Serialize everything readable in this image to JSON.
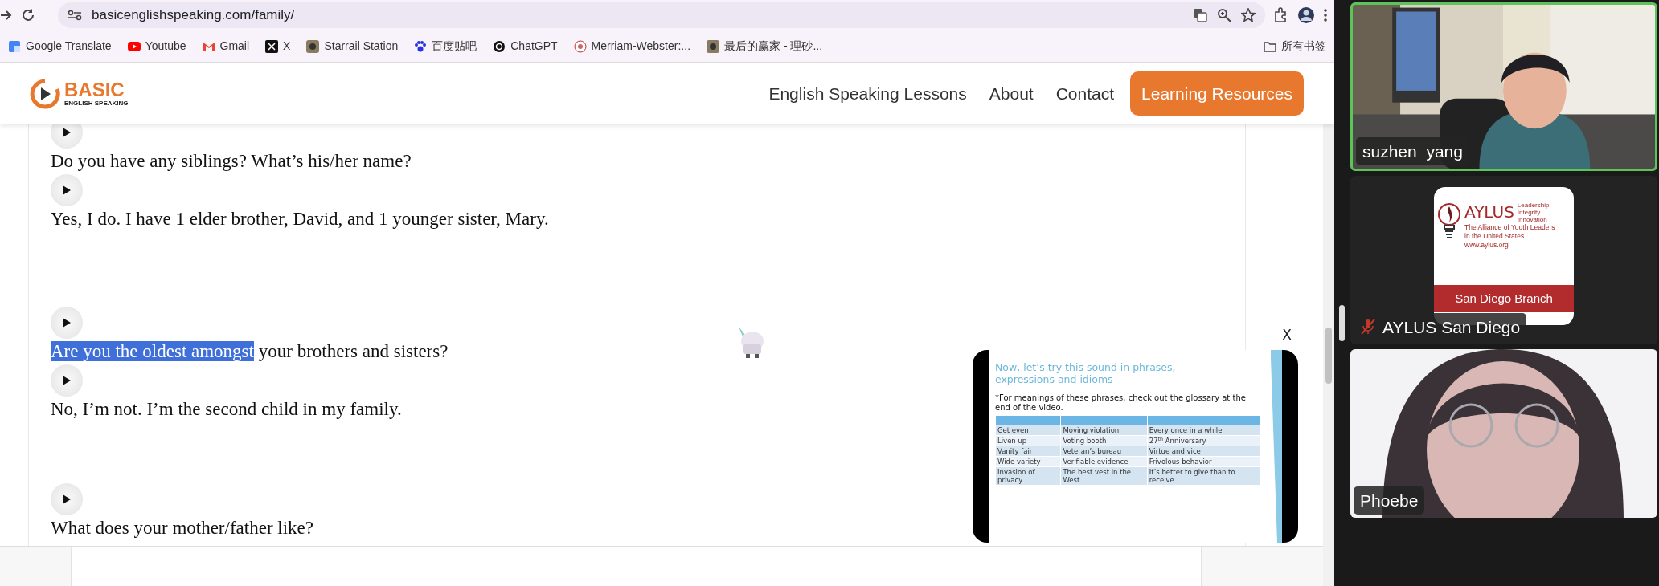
{
  "browser": {
    "url": "basicenglishspeaking.com/family/",
    "bookmarks": [
      {
        "label": "Google Translate",
        "kind": "translate"
      },
      {
        "label": "Youtube",
        "kind": "video"
      },
      {
        "label": "Gmail",
        "kind": "mail"
      },
      {
        "label": "X",
        "kind": "x"
      },
      {
        "label": "Starrail Station",
        "kind": "game"
      },
      {
        "label": "百度贴吧",
        "kind": "paw"
      },
      {
        "label": "ChatGPT",
        "kind": "chat"
      },
      {
        "label": "Merriam-Webster:...",
        "kind": "dictionary"
      },
      {
        "label": "最后的赢家 - 理砂...",
        "kind": "game"
      }
    ],
    "all_bookmarks": "所有书签"
  },
  "site": {
    "logo": {
      "title": "BASIC",
      "subtitle": "ENGLISH SPEAKING"
    },
    "nav": [
      {
        "label": "English Speaking Lessons"
      },
      {
        "label": "About"
      },
      {
        "label": "Contact"
      }
    ],
    "cta": "Learning Resources",
    "items": [
      {
        "kind": "play"
      },
      {
        "kind": "line",
        "segments": [
          {
            "text": "Do you have any siblings? What’s his/her name?",
            "selected": false
          }
        ]
      },
      {
        "kind": "play"
      },
      {
        "kind": "line",
        "segments": [
          {
            "text": "Yes, I do. I have 1 elder brother, David, and 1 younger sister, Mary.",
            "selected": false
          }
        ]
      },
      {
        "kind": "gap"
      },
      {
        "kind": "play"
      },
      {
        "kind": "line",
        "segments": [
          {
            "text": "Are you the oldest amongst",
            "selected": true
          },
          {
            "text": " your brothers and sisters?",
            "selected": false
          }
        ]
      },
      {
        "kind": "play"
      },
      {
        "kind": "line",
        "segments": [
          {
            "text": "No, I’m not. I’m the second child in my family.",
            "selected": false
          }
        ]
      },
      {
        "kind": "gap"
      },
      {
        "kind": "play"
      },
      {
        "kind": "line",
        "segments": [
          {
            "text": "What does your mother/father like?",
            "selected": false
          }
        ]
      }
    ]
  },
  "video_popup": {
    "close": "X",
    "slide": {
      "title": "Now, let’s try this sound in phrases, expressions and idioms",
      "note": "*For meanings of these phrases, check out the glossary at the end of the video.",
      "rows": [
        [
          "Get even",
          "Moving violation",
          "Every once in a while"
        ],
        [
          "Liven up",
          "Voting booth",
          "27$^{th}$ Anniversary"
        ],
        [
          "Vanity fair",
          "Veteran’s bureau",
          "Virtue and vice"
        ],
        [
          "Wide variety",
          "Verifiable evidence",
          "Frivolous behavior"
        ],
        [
          "Invasion of privacy",
          "The best vest in the West",
          "It’s better to give than to receive."
        ]
      ]
    }
  },
  "meeting": {
    "participants": [
      {
        "name": "suzhen  yang",
        "kind": "video",
        "speaking": true,
        "muted": false
      },
      {
        "name": "AYLUS San Diego",
        "kind": "logo",
        "speaking": false,
        "muted": true,
        "logo": {
          "title": "AYLUS",
          "motto": [
            "Leadership",
            "Integrity",
            "Innovation"
          ],
          "lines": [
            "The Alliance of Youth Leaders",
            "in the United States"
          ],
          "url": "www.aylus.org",
          "branch": "San Diego Branch"
        }
      },
      {
        "name": "Phoebe",
        "kind": "video",
        "speaking": false,
        "muted": false
      }
    ]
  }
}
